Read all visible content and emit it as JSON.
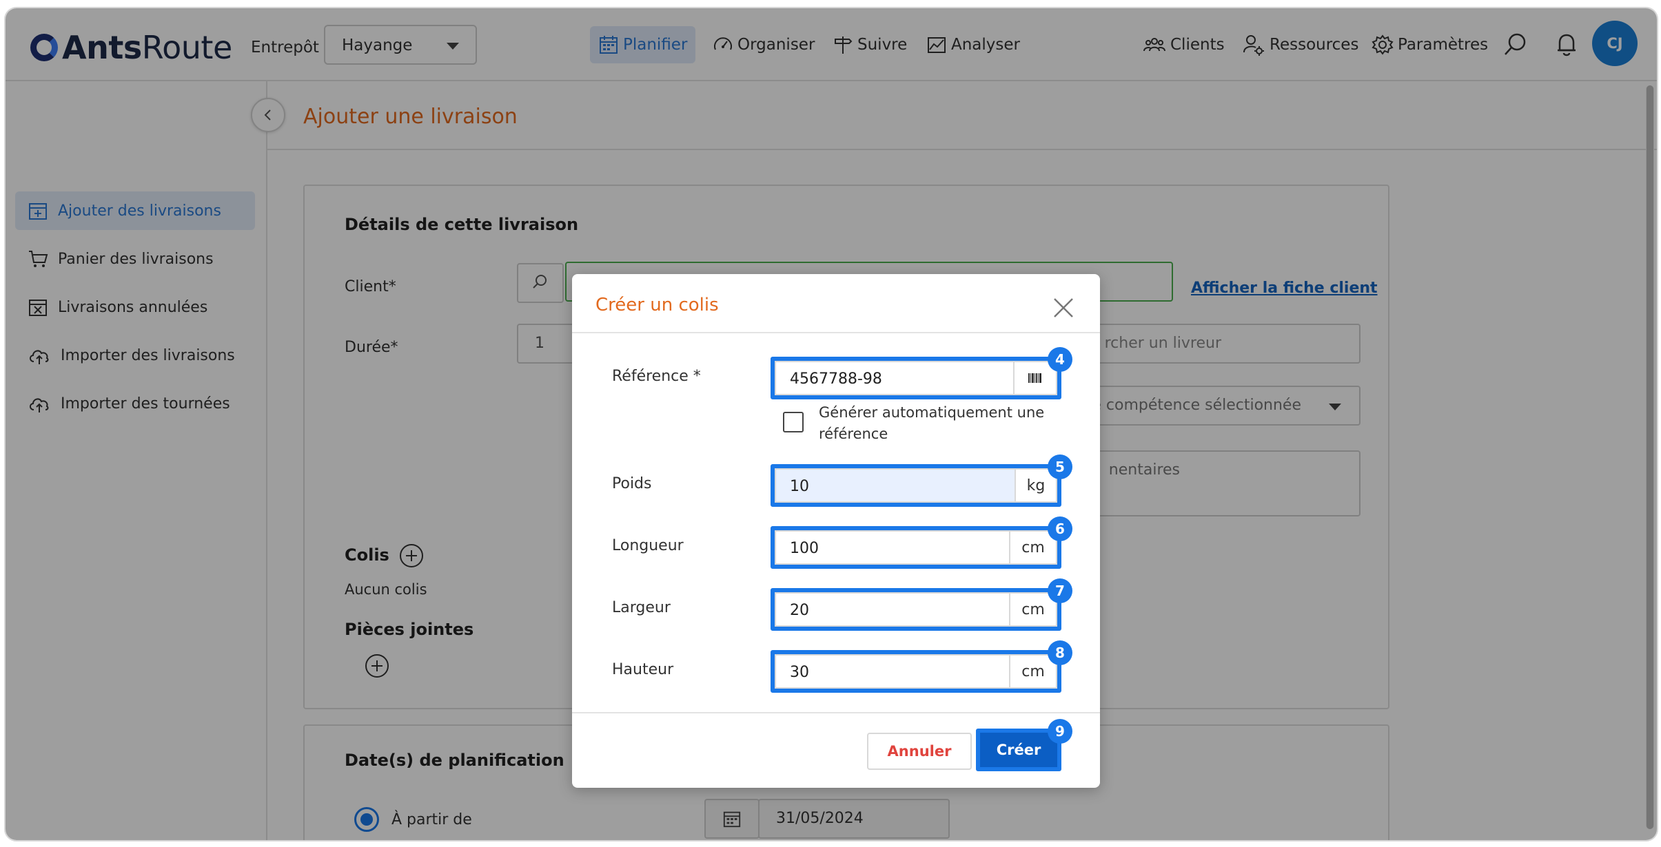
{
  "brand": {
    "name_bold": "Ants",
    "name_light": "Route"
  },
  "warehouse": {
    "label": "Entrepôt",
    "value": "Hayange"
  },
  "nav": {
    "planifier": "Planifier",
    "organiser": "Organiser",
    "suivre": "Suivre",
    "analyser": "Analyser",
    "clients": "Clients",
    "ressources": "Ressources",
    "parametres": "Paramètres"
  },
  "user": {
    "initials": "CJ"
  },
  "sidebar": {
    "items": [
      {
        "label": "Ajouter des livraisons",
        "icon": "calendar-plus-icon",
        "active": true
      },
      {
        "label": "Panier des livraisons",
        "icon": "cart-icon",
        "active": false
      },
      {
        "label": "Livraisons annulées",
        "icon": "calendar-x-icon",
        "active": false
      },
      {
        "label": "Importer des livraisons",
        "icon": "cloud-upload-icon",
        "active": false
      },
      {
        "label": "Importer des tournées",
        "icon": "cloud-upload-icon",
        "active": false
      }
    ]
  },
  "page": {
    "title": "Ajouter une livraison"
  },
  "details": {
    "title": "Détails de cette livraison",
    "client_label": "Client*",
    "show_client_link": "Afficher la fiche client",
    "duration_label": "Durée*",
    "duration_value": "1",
    "driver_placeholder_partial": "rcher un livreur",
    "skill_partial": "e compétence sélectionnée",
    "comments_partial": "nentaires",
    "parcels_title": "Colis",
    "parcels_empty": "Aucun colis",
    "attachments_title": "Pièces jointes"
  },
  "planning": {
    "title": "Date(s) de planification",
    "from_label": "À partir de",
    "from_date": "31/05/2024"
  },
  "modal": {
    "title": "Créer un colis",
    "reference_label": "Référence *",
    "reference_value": "4567788-98",
    "auto_ref_label": "Générer automatiquement une référence",
    "weight_label": "Poids",
    "weight_value": "10",
    "weight_unit": "kg",
    "length_label": "Longueur",
    "length_value": "100",
    "length_unit": "cm",
    "width_label": "Largeur",
    "width_value": "20",
    "width_unit": "cm",
    "height_label": "Hauteur",
    "height_value": "30",
    "height_unit": "cm",
    "cancel_label": "Annuler",
    "create_label": "Créer"
  },
  "badges": {
    "reference": "4",
    "weight": "5",
    "length": "6",
    "width": "7",
    "height": "8",
    "create": "9"
  },
  "colors": {
    "accent": "#2a78d4",
    "title_orange": "#e26a1f",
    "highlight": "#1a78e8",
    "danger": "#e0443e"
  }
}
